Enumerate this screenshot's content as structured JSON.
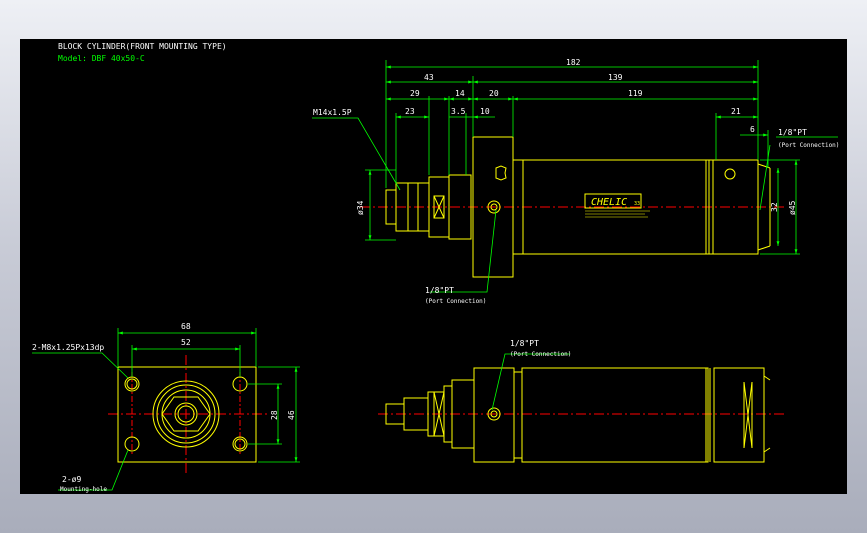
{
  "title": {
    "line1": "BLOCK CYLINDER(FRONT MOUNTING TYPE)",
    "line2": "Model: DBF 40x50-C"
  },
  "colors": {
    "background": "#000000",
    "outline": "#ffff00",
    "dimension": "#00ff00",
    "centerline": "#ff0000",
    "text_white": "#ffffff",
    "frame": "#c4c8d3"
  },
  "top_view": {
    "dims": {
      "overall": "182",
      "d43": "43",
      "d139": "139",
      "d29": "29",
      "d14": "14",
      "d20": "20",
      "d119": "119",
      "d23": "23",
      "d3_5": "3.5",
      "d10": "10",
      "d21": "21",
      "d6": "6",
      "dia34": "ø34",
      "d32": "32",
      "dia45": "ø45"
    },
    "thread_label": "M14x1.5P",
    "port_right_label": "1/8\"PT",
    "port_right_sub": "(Port Connection)",
    "port_bottom_label": "1/8\"PT",
    "port_bottom_sub": "(Port Connection)",
    "brand": "CHELIC",
    "brand_suffix": "33"
  },
  "front_view": {
    "d68": "68",
    "d52": "52",
    "d28": "28",
    "d46": "46",
    "tap_label": "2-M8x1.25Px13dp",
    "hole_label": "2-ø9",
    "hole_sub": "Mounting-hole"
  },
  "side_view": {
    "port_label": "1/8\"PT",
    "port_sub": "(Port Connection)"
  }
}
